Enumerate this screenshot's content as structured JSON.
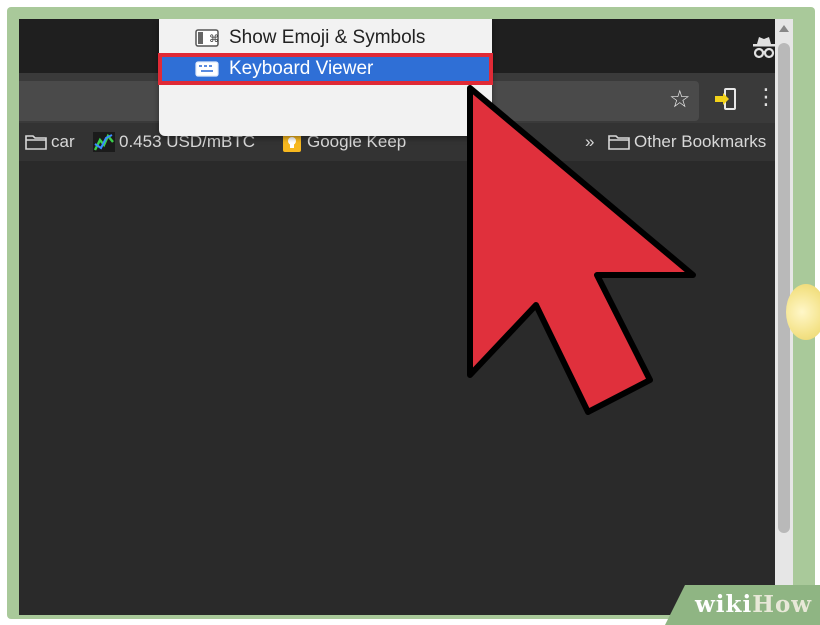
{
  "menu": {
    "items": [
      {
        "label": "Show Emoji & Symbols",
        "icon": "emoji-symbols-icon",
        "selected": false
      },
      {
        "label": "Keyboard Viewer",
        "icon": "keyboard-icon",
        "selected": true
      }
    ]
  },
  "bookmarks": {
    "items": [
      {
        "label": "car",
        "icon": "folder-icon"
      },
      {
        "label": "0.453 USD/mBTC",
        "icon": "chart-icon"
      },
      {
        "label": "Google Keep",
        "icon": "google-keep-icon"
      }
    ],
    "overflow": "»",
    "other": {
      "label": "Other Bookmarks",
      "icon": "folder-icon"
    }
  },
  "toolbar": {
    "star": "☆",
    "menu": "⋮"
  },
  "watermark": {
    "prefix": "wiki",
    "suffix": "How"
  },
  "colors": {
    "highlight": "#2f6fd6",
    "outline": "#e02a36",
    "pointer": "#e0303c",
    "frame": "#a9c99a"
  }
}
